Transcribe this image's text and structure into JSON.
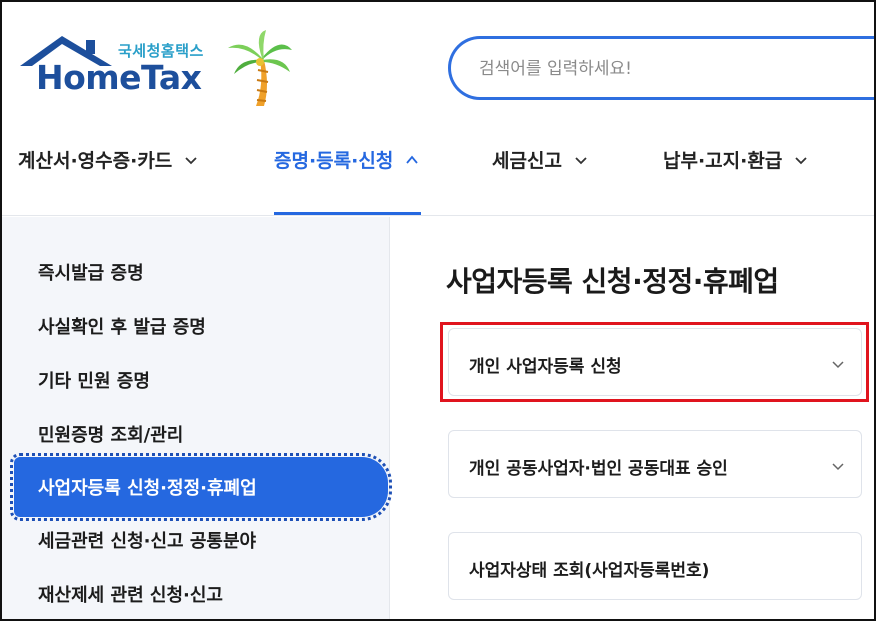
{
  "header": {
    "logo_kr": "국세청홈택스",
    "logo_en": "HomeTax",
    "search_placeholder": "검색어를 입력하세요!"
  },
  "topnav": {
    "items": [
      {
        "label": "계산서·영수증·카드",
        "active": false
      },
      {
        "label": "증명·등록·신청",
        "active": true
      },
      {
        "label": "세금신고",
        "active": false
      },
      {
        "label": "납부·고지·환급",
        "active": false
      }
    ]
  },
  "sidebar": {
    "items": [
      {
        "label": "즉시발급 증명"
      },
      {
        "label": "사실확인 후 발급 증명"
      },
      {
        "label": "기타 민원 증명"
      },
      {
        "label": "민원증명 조회/관리"
      },
      {
        "label": "사업자등록 신청·정정·휴폐업",
        "active": true
      },
      {
        "label": "세금관련 신청·신고 공통분야"
      },
      {
        "label": "재산제세 관련 신청·신고"
      }
    ]
  },
  "main": {
    "title": "사업자등록 신청·정정·휴폐업",
    "cards": [
      {
        "label": "개인 사업자등록 신청",
        "expandable": true,
        "highlighted": true
      },
      {
        "label": "개인 공동사업자·법인 공동대표 승인",
        "expandable": true
      },
      {
        "label": "사업자상태 조회(사업자등록번호)",
        "expandable": false
      }
    ]
  },
  "colors": {
    "accent": "#2568e0",
    "highlight": "#e0141e",
    "sidebar_bg": "#f4f6fa",
    "logo_blue": "#1d4f9c",
    "logo_teal": "#2a9fc9"
  }
}
